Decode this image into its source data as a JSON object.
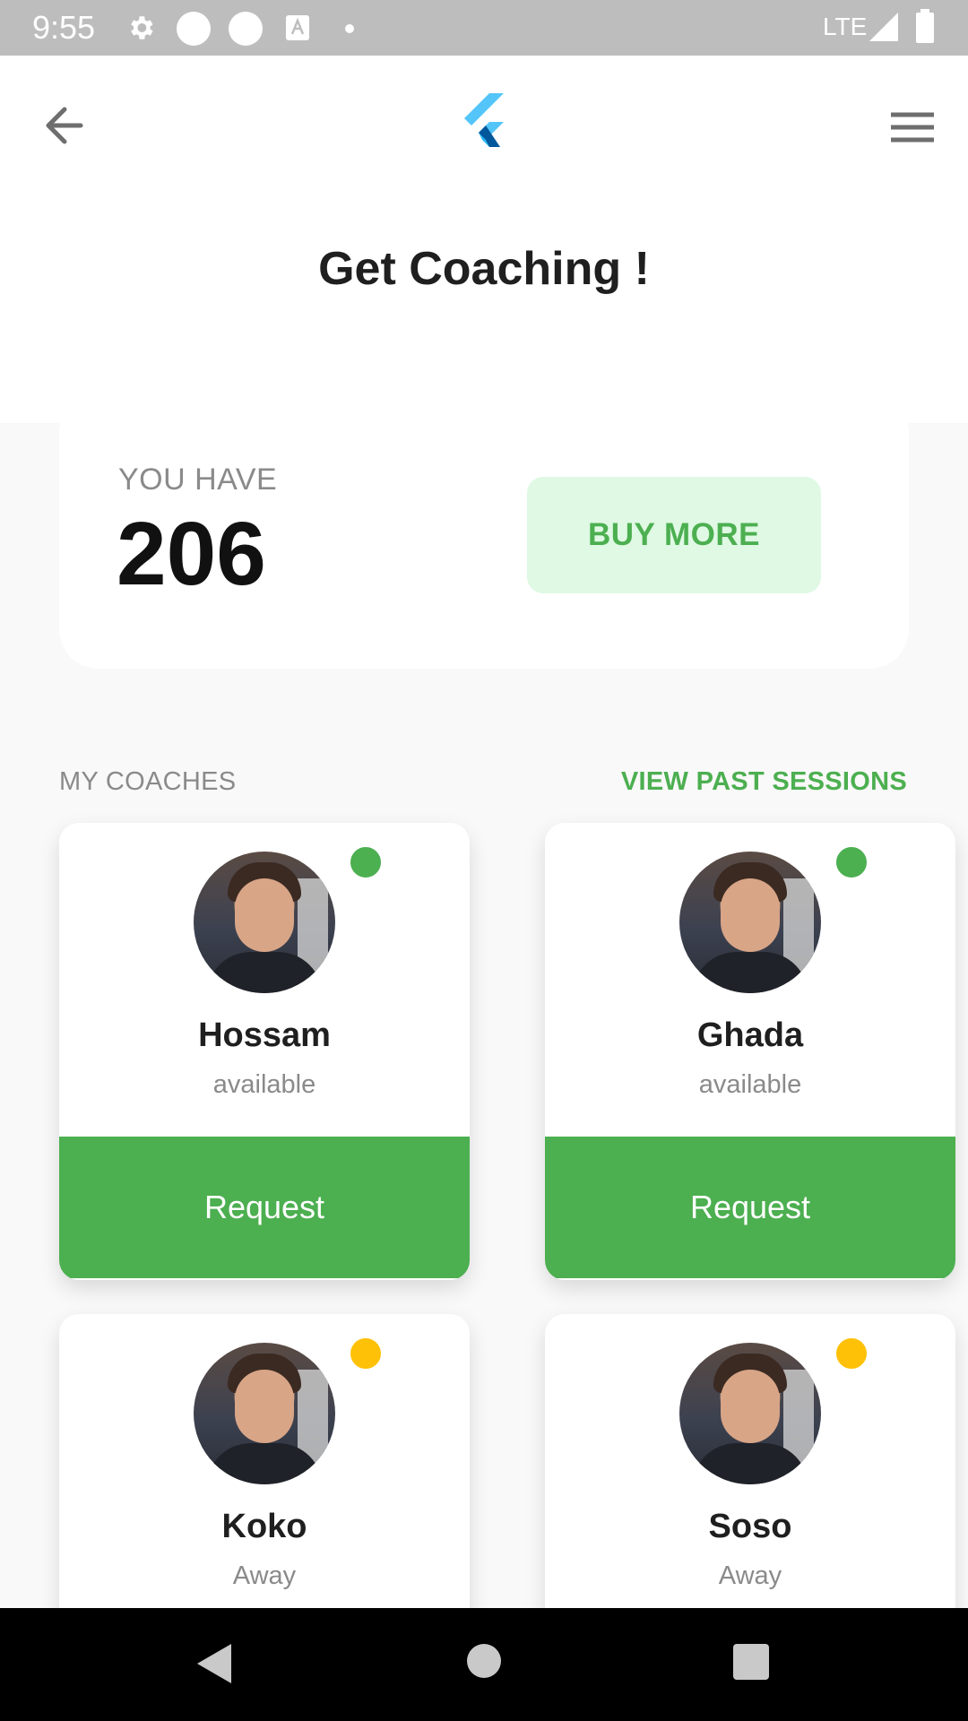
{
  "status_bar": {
    "time": "9:55",
    "network": "LTE",
    "icons": [
      "gear-icon",
      "circle-icon",
      "circle-icon",
      "font-download-icon",
      "dot-icon",
      "signal-icon",
      "battery-icon"
    ]
  },
  "header": {
    "back_icon": "arrow-back-icon",
    "logo_icon": "flutter-logo",
    "menu_icon": "hamburger-menu-icon",
    "title": "Get Coaching !"
  },
  "balance": {
    "label": "YOU HAVE",
    "value": "206",
    "buy_more_label": "BUY MORE"
  },
  "coaches_section": {
    "label": "MY COACHES",
    "past_sessions_label": "VIEW PAST SESSIONS"
  },
  "coaches": [
    {
      "name": "Hossam",
      "status": "available",
      "status_color": "#4caf50",
      "request_label": "Request"
    },
    {
      "name": "Ghada",
      "status": "available",
      "status_color": "#4caf50",
      "request_label": "Request"
    },
    {
      "name": "Koko",
      "status": "Away",
      "status_color": "#ffc107"
    },
    {
      "name": "Soso",
      "status": "Away",
      "status_color": "#ffc107"
    }
  ],
  "colors": {
    "accent_green": "#4caf50",
    "buy_more_bg": "#dff9e4",
    "away_yellow": "#ffc107"
  },
  "nav_bar": {
    "icons": [
      "nav-back-icon",
      "nav-home-icon",
      "nav-recents-icon"
    ]
  }
}
